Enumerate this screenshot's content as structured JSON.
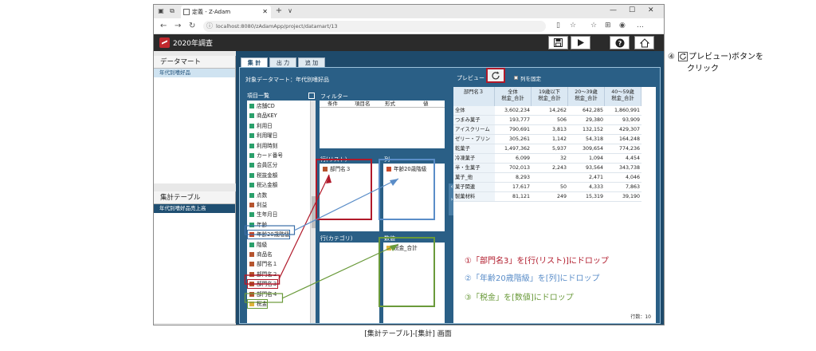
{
  "browser": {
    "tab_title": "定義 - Z-Adam",
    "url": "localhost:8080/zAdamApp/project/datamart/13",
    "new_tab": "+",
    "tab_menu": "∨"
  },
  "app": {
    "title": "2020年調査"
  },
  "left": {
    "datamart_title": "データマート",
    "datamart_items": [
      "年代別嗜好品"
    ],
    "table_title": "集計テーブル",
    "table_items": [
      "年代別嗜好品売上高"
    ]
  },
  "tabs": [
    "集 計",
    "出 力",
    "追 加"
  ],
  "work": {
    "target_label": "対象データマート：年代別嗜好品",
    "itemlist_title": "項目一覧",
    "filter_title": "フィルター",
    "filter_cols": [
      "条件",
      "項目名",
      "形式",
      "値"
    ],
    "rows_label": "行(リスト)",
    "cols_label": "列",
    "cat_label": "行(カテゴリ)",
    "values_label": "数値",
    "rows_chip": "部門名３",
    "cols_chip": "年齢20歳階級",
    "values_chip": "税金_合計",
    "preview_label": "プレビュー",
    "col_fixed_label": "列を固定",
    "row_count": "行数：10"
  },
  "items": [
    {
      "label": "店舗CD",
      "type": "t"
    },
    {
      "label": "商品KEY",
      "type": "t"
    },
    {
      "label": "利用日",
      "type": "t"
    },
    {
      "label": "利用曜日",
      "type": "t"
    },
    {
      "label": "利用時刻",
      "type": "t"
    },
    {
      "label": "カード番号",
      "type": "t"
    },
    {
      "label": "会員区分",
      "type": "t"
    },
    {
      "label": "税抜金額",
      "type": "t"
    },
    {
      "label": "税込金額",
      "type": "t"
    },
    {
      "label": "点数",
      "type": "t"
    },
    {
      "label": "利益",
      "type": "a"
    },
    {
      "label": "生年月日",
      "type": "t"
    },
    {
      "label": "年齢",
      "type": "t"
    },
    {
      "label": "年齢20歳階級",
      "type": "c"
    },
    {
      "label": "階級",
      "type": "t"
    },
    {
      "label": "商品名",
      "type": "a"
    },
    {
      "label": "部門名１",
      "type": "a"
    },
    {
      "label": "部門名２",
      "type": "a"
    },
    {
      "label": "部門名３",
      "type": "a"
    },
    {
      "label": "部門名４",
      "type": "a"
    },
    {
      "label": "税金",
      "type": "y"
    }
  ],
  "preview_table": {
    "headers": [
      "部門名３",
      "全体\n税金_合計",
      "19歳以下\n税金_合計",
      "20～39歳\n税金_合計",
      "40～59歳\n税金_合計"
    ],
    "rows": [
      [
        "全体",
        "3,602,234",
        "14,262",
        "642,285",
        "1,860,991"
      ],
      [
        "つまみ菓子",
        "193,777",
        "506",
        "29,380",
        "93,909"
      ],
      [
        "アイスクリーム",
        "790,691",
        "3,813",
        "132,152",
        "429,307"
      ],
      [
        "ゼリー・プリン",
        "305,261",
        "1,142",
        "54,318",
        "164,248"
      ],
      [
        "乾菓子",
        "1,497,362",
        "5,937",
        "309,654",
        "774,236"
      ],
      [
        "冷凍菓子",
        "6,099",
        "32",
        "1,094",
        "4,454"
      ],
      [
        "半・生菓子",
        "702,013",
        "2,243",
        "93,564",
        "343,738"
      ],
      [
        "菓子_他",
        "8,293",
        "",
        "2,471",
        "4,046"
      ],
      [
        "菓子関連",
        "17,617",
        "50",
        "4,333",
        "7,863"
      ],
      [
        "製菓材料",
        "81,121",
        "249",
        "15,319",
        "39,190"
      ]
    ]
  },
  "annotations": {
    "note4": "④",
    "note4b": "プレビュー)ボタンを",
    "note4c": "クリック",
    "note1": "①「部門名3」を[行(リスト)]にドロップ",
    "note2": "②「年齢20歳階級」を[列]にドロップ",
    "note3": "③「税金」を[数値]にドロップ"
  },
  "caption": "[集計テーブル]-[集計] 画面",
  "colors": {
    "main_bg": "#1e4a6b",
    "red": "#b0192a",
    "blue": "#3a6fa8",
    "green": "#6a9a3a"
  }
}
